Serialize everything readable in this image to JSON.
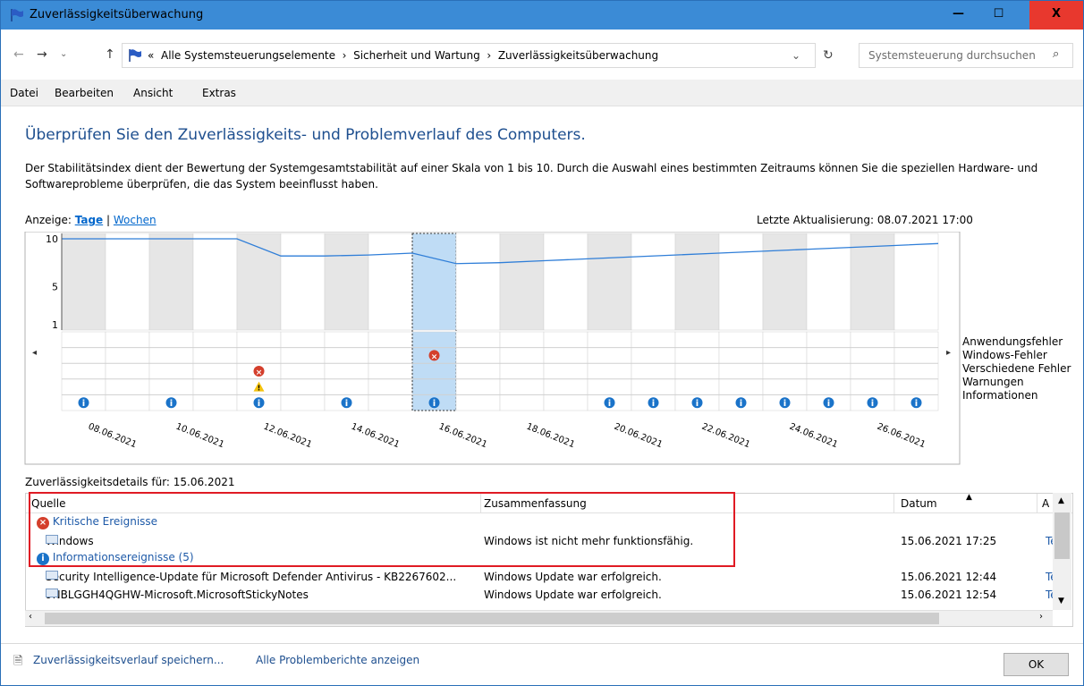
{
  "window": {
    "title": "Zuverlässigkeitsüberwachung",
    "min": "—",
    "max": "☐",
    "close": "X"
  },
  "address": {
    "crumb_prefix": "«",
    "crumb1": "Alle Systemsteuerungselemente",
    "crumb2": "Sicherheit und Wartung",
    "crumb3": "Zuverlässigkeitsüberwachung",
    "search_placeholder": "Systemsteuerung durchsuchen"
  },
  "menu": {
    "file": "Datei",
    "edit": "Bearbeiten",
    "view": "Ansicht",
    "extras": "Extras"
  },
  "content": {
    "heading": "Überprüfen Sie den Zuverlässigkeits- und Problemverlauf des Computers.",
    "description": "Der Stabilitätsindex dient der Bewertung der Systemgesamtstabilität auf einer Skala von 1 bis 10. Durch die Auswahl eines bestimmten Zeitraums können Sie die speziellen Hardware- und Softwareprobleme überprüfen, die das System beeinflusst haben.",
    "view_label": "Anzeige:",
    "view_days": "Tage",
    "view_sep": "|",
    "view_weeks": "Wochen",
    "last_update": "Letzte Aktualisierung: 08.07.2021 17:00"
  },
  "chart_data": {
    "type": "line",
    "title": "",
    "ylabel": "",
    "ylim": [
      1,
      10
    ],
    "yticks": [
      "10",
      "5",
      "1"
    ],
    "date_labels": [
      "08.06.2021",
      "10.06.2021",
      "12.06.2021",
      "14.06.2021",
      "16.06.2021",
      "18.06.2021",
      "20.06.2021",
      "22.06.2021",
      "24.06.2021",
      "26.06.2021"
    ],
    "columns": 20,
    "selected_column": 8,
    "stability_index": [
      10,
      10,
      10,
      10,
      10,
      8.2,
      8.2,
      8.3,
      8.5,
      7.4,
      7.5,
      7.7,
      7.9,
      8.1,
      8.3,
      8.5,
      8.7,
      8.9,
      9.1,
      9.3,
      9.5
    ],
    "categories": [
      "Anwendungsfehler",
      "Windows-Fehler",
      "Verschiedene Fehler",
      "Warnungen",
      "Informationen"
    ],
    "events": {
      "Verschiedene Fehler": [
        4
      ],
      "Warnungen": [
        4
      ],
      "Windows-Fehler": [
        8
      ],
      "Informationen": [
        0,
        2,
        4,
        6,
        8,
        12,
        13,
        14,
        15,
        16,
        17,
        18,
        19
      ]
    }
  },
  "details": {
    "label": "Zuverlässigkeitsdetails für: 15.06.2021",
    "columns": {
      "source": "Quelle",
      "summary": "Zusammenfassung",
      "date": "Datum",
      "action": "A"
    },
    "groups": [
      {
        "title": "Kritische Ereignisse",
        "rows": [
          {
            "source": "Windows",
            "summary": "Windows ist nicht mehr funktionsfähig.",
            "date": "15.06.2021 17:25",
            "action": "Te"
          }
        ]
      },
      {
        "title": "Informationsereignisse (5)",
        "rows": [
          {
            "source": "Security Intelligence-Update für Microsoft Defender Antivirus - KB2267602...",
            "summary": "Windows Update war erfolgreich.",
            "date": "15.06.2021 12:44",
            "action": "Te"
          },
          {
            "source": "9NBLGGH4QGHW-Microsoft.MicrosoftStickyNotes",
            "summary": "Windows Update war erfolgreich.",
            "date": "15.06.2021 12:54",
            "action": "Te"
          }
        ]
      }
    ]
  },
  "footer": {
    "save_link": "Zuverlässigkeitsverlauf speichern...",
    "reports_link": "Alle Problemberichte anzeigen",
    "ok": "OK"
  }
}
